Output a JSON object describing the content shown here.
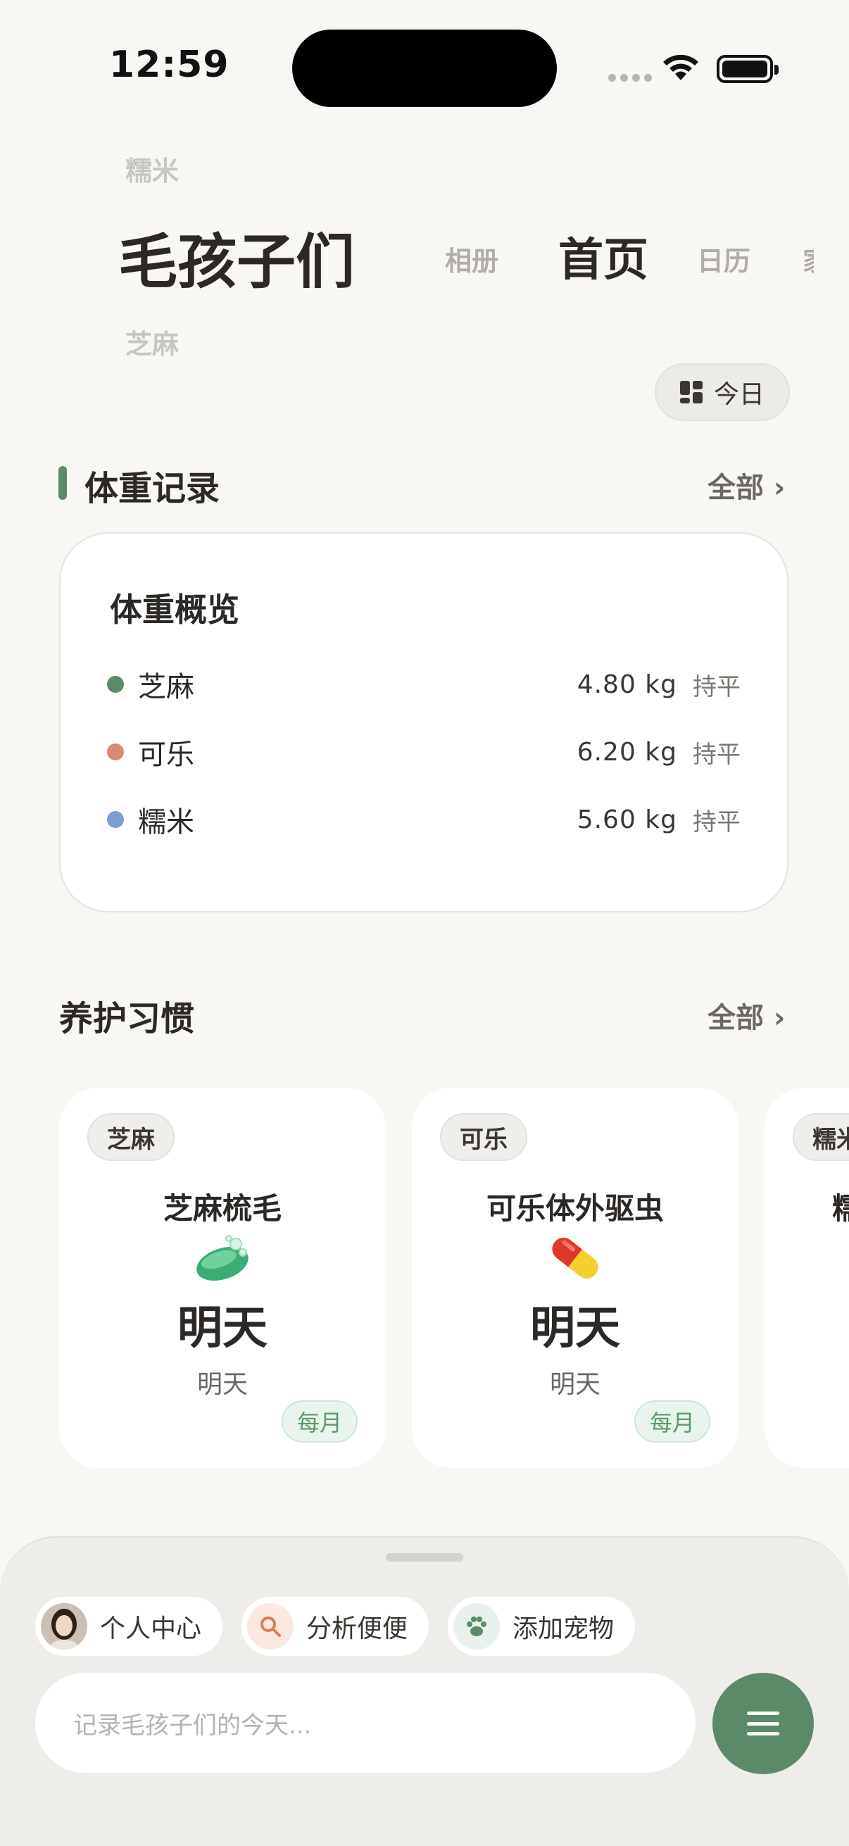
{
  "status_bar": {
    "time": "12:59"
  },
  "pet_picker": {
    "above": "糯米",
    "current": "毛孩子们",
    "below": "芝麻"
  },
  "tabs": [
    {
      "label": "相册"
    },
    {
      "label": "首页"
    },
    {
      "label": "日历"
    },
    {
      "label": "家"
    }
  ],
  "today_button": {
    "label": "今日",
    "icon": "grid-icon"
  },
  "weight_section": {
    "title": "体重记录",
    "all_label": "全部 ›",
    "card_title": "体重概览",
    "rows": [
      {
        "name": "芝麻",
        "value": "4.80 kg",
        "trend": "持平",
        "color": "#5b8a68"
      },
      {
        "name": "可乐",
        "value": "6.20 kg",
        "trend": "持平",
        "color": "#d98a70"
      },
      {
        "name": "糯米",
        "value": "5.60 kg",
        "trend": "持平",
        "color": "#7d9ed0"
      }
    ]
  },
  "habits_section": {
    "title": "养护习惯",
    "all_label": "全部 ›",
    "cards": [
      {
        "pet": "芝麻",
        "name": "芝麻梳毛",
        "icon": "soap-icon",
        "due": "明天",
        "sub": "明天",
        "frequency": "每月"
      },
      {
        "pet": "可乐",
        "name": "可乐体外驱虫",
        "icon": "pill-icon",
        "due": "明天",
        "sub": "明天",
        "frequency": "每月"
      },
      {
        "pet": "糯米",
        "name": "糯米",
        "icon": "",
        "due": "",
        "sub": "",
        "frequency": ""
      }
    ]
  },
  "bottom_sheet": {
    "chips": [
      {
        "label": "个人中心",
        "icon": "avatar"
      },
      {
        "label": "分析便便",
        "icon": "search-icon",
        "color": "#e07a5a"
      },
      {
        "label": "添加宠物",
        "icon": "paw-icon",
        "color": "#5b8a68"
      }
    ],
    "input_placeholder": "记录毛孩子们的今天...",
    "menu_icon": "menu-icon"
  },
  "colors": {
    "accent": "#5b8a68",
    "background": "#f8f7f4"
  }
}
